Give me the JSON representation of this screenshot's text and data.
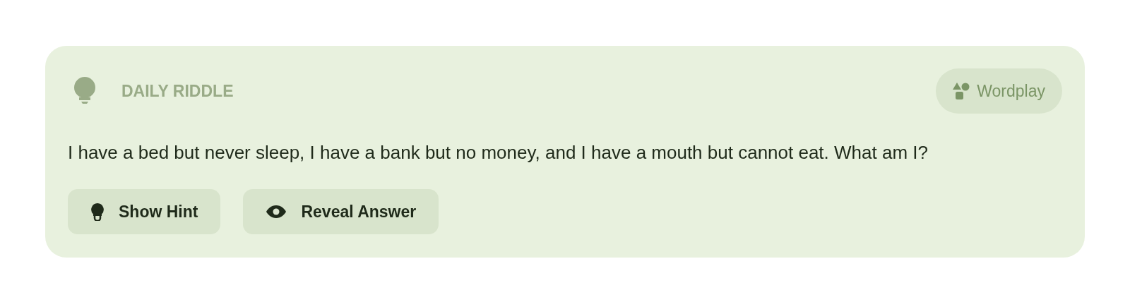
{
  "card": {
    "label": "DAILY RIDDLE",
    "category": "Wordplay",
    "question": "I have a bed but never sleep, I have a bank but no money, and I have a mouth but cannot eat. What am I?",
    "buttons": [
      {
        "kind": "hint",
        "label": "Show Hint"
      },
      {
        "kind": "reveal",
        "label": "Reveal Answer"
      }
    ]
  }
}
